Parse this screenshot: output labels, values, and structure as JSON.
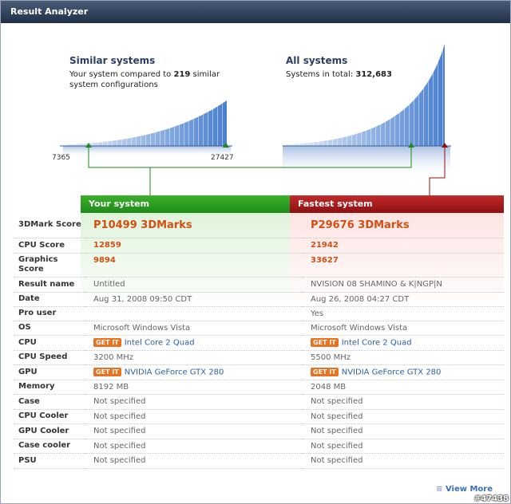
{
  "window_title": "Result Analyzer",
  "similar": {
    "title": "Similar systems",
    "line1_prefix": "Your system compared to ",
    "count": "219",
    "line1_suffix": " similar",
    "line2": "system configurations",
    "axis_min": "7365",
    "axis_max": "27427"
  },
  "all": {
    "title": "All systems",
    "line1_prefix": "Systems in total: ",
    "total": "312,683"
  },
  "columns": {
    "your": "Your system",
    "fastest": "Fastest system"
  },
  "rows": [
    {
      "label": "3DMark Score",
      "your": "P10499 3DMarks",
      "fastest": "P29676 3DMarks"
    },
    {
      "label": "CPU Score",
      "your": "12859",
      "fastest": "21942"
    },
    {
      "label": "Graphics Score",
      "your": "9894",
      "fastest": "33627"
    },
    {
      "label": "Result name",
      "your": "Untitled",
      "fastest": "NVISION 08 SHAMINO & K|NGP|N"
    },
    {
      "label": "Date",
      "your": "Aug 31, 2008 09:50 CDT",
      "fastest": "Aug 26, 2008 04:27 CDT"
    },
    {
      "label": "Pro user",
      "your": "",
      "fastest": "Yes"
    },
    {
      "label": "OS",
      "your": "Microsoft Windows Vista",
      "fastest": "Microsoft Windows Vista"
    },
    {
      "label": "CPU",
      "your": "Intel Core 2 Quad",
      "fastest": "Intel Core 2 Quad",
      "getit": "GET IT"
    },
    {
      "label": "CPU Speed",
      "your": "3200 MHz",
      "fastest": "5500 MHz"
    },
    {
      "label": "GPU",
      "your": "NVIDIA GeForce GTX 280",
      "fastest": "NVIDIA GeForce GTX 280",
      "getit": "GET IT"
    },
    {
      "label": "Memory",
      "your": "8192 MB",
      "fastest": "2048 MB"
    },
    {
      "label": "Case",
      "your": "Not specified",
      "fastest": "Not specified"
    },
    {
      "label": "CPU Cooler",
      "your": "Not specified",
      "fastest": "Not specified"
    },
    {
      "label": "GPU Cooler",
      "your": "Not specified",
      "fastest": "Not specified"
    },
    {
      "label": "Case cooler",
      "your": "Not specified",
      "fastest": "Not specified"
    },
    {
      "label": "PSU",
      "your": "Not specified",
      "fastest": "Not specified"
    }
  ],
  "view_more": "View More",
  "watermark": "#47438",
  "colors": {
    "your": "#1e8a17",
    "fastest": "#8d0f10",
    "score": "#d24f14"
  }
}
